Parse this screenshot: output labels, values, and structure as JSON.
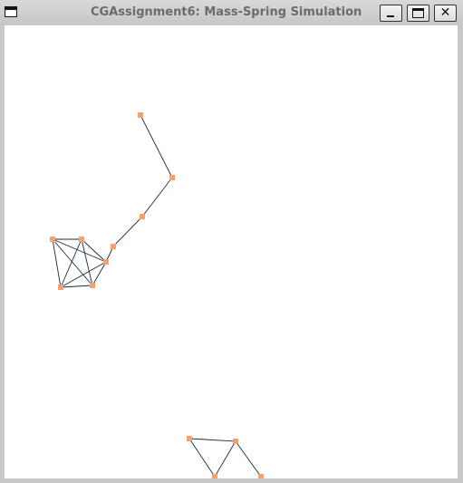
{
  "window": {
    "title": "CGAssignment6: Mass-Spring Simulation",
    "buttons": {
      "minimize_icon": "minimize-icon",
      "maximize_icon": "maximize-icon",
      "close_icon": "close-icon"
    }
  },
  "colors": {
    "mass": "#f7a070",
    "spring": "#1a2a3a"
  }
}
